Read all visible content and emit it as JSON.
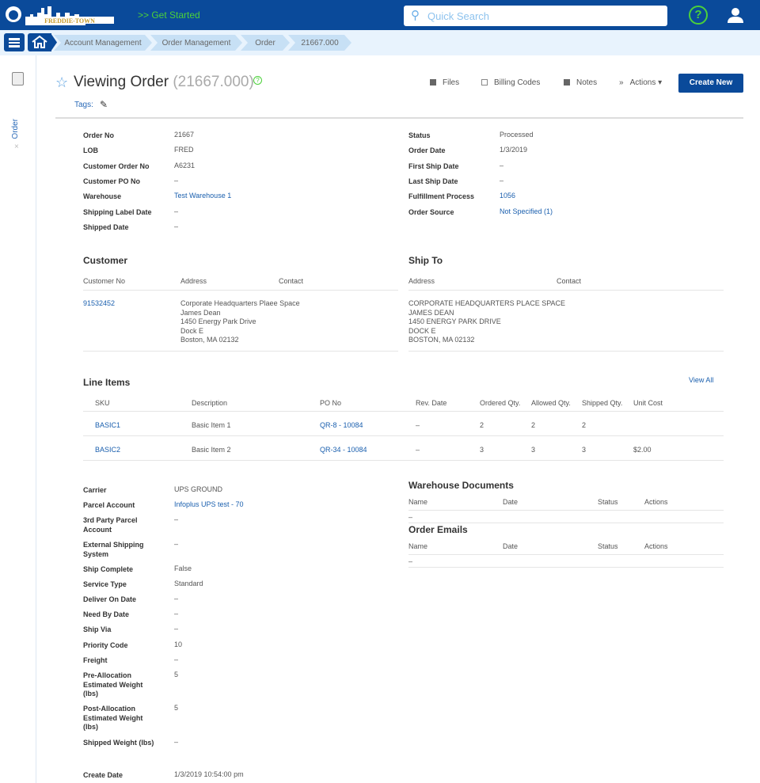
{
  "header": {
    "logo_text": "FREDDIE-TOWN",
    "get_started": ">> Get Started",
    "search_placeholder": "Quick Search",
    "help": "?"
  },
  "breadcrumb": [
    "Account Management",
    "Order Management",
    "Order",
    "21667.000"
  ],
  "sidebar": {
    "tab": "Order",
    "close": "×"
  },
  "page": {
    "title": "Viewing Order",
    "order_id": "(21667.000)",
    "tags_label": "Tags:"
  },
  "toolbar": {
    "files": "Files",
    "billing_codes": "Billing Codes",
    "notes": "Notes",
    "actions": "Actions ▾",
    "create_new": "Create New"
  },
  "order_fields_left": [
    {
      "label": "Order No",
      "value": "21667"
    },
    {
      "label": "LOB",
      "value": "FRED"
    },
    {
      "label": "Customer Order No",
      "value": "A6231"
    },
    {
      "label": "Customer PO No",
      "value": "–"
    },
    {
      "label": "Warehouse",
      "value": "Test Warehouse 1",
      "link": true
    },
    {
      "label": "Shipping Label Date",
      "value": "–"
    },
    {
      "label": "Shipped Date",
      "value": "–"
    }
  ],
  "order_fields_right": [
    {
      "label": "Status",
      "value": "Processed"
    },
    {
      "label": "Order Date",
      "value": "1/3/2019"
    },
    {
      "label": "First Ship Date",
      "value": "–"
    },
    {
      "label": "Last Ship Date",
      "value": "–"
    },
    {
      "label": "Fulfillment Process",
      "value": "1056",
      "link": true
    },
    {
      "label": "Order Source",
      "value": "Not Specified (1)",
      "link": true
    }
  ],
  "customer": {
    "heading": "Customer",
    "cols": [
      "Customer No",
      "Address",
      "Contact"
    ],
    "customer_no": "91532452",
    "address": [
      "Corporate Headquarters Plaee Space",
      "James Dean",
      "1450 Energy Park Drive",
      "Dock E",
      "Boston, MA 02132"
    ]
  },
  "ship_to": {
    "heading": "Ship To",
    "cols": [
      "Address",
      "Contact"
    ],
    "address": [
      "CORPORATE HEADQUARTERS PLACE SPACE",
      "JAMES DEAN",
      "1450 ENERGY PARK DRIVE",
      "DOCK E",
      "BOSTON, MA 02132"
    ]
  },
  "line_items": {
    "heading": "Line Items",
    "view_all": "View All",
    "cols": [
      "SKU",
      "Description",
      "PO No",
      "Rev. Date",
      "Ordered Qty.",
      "Allowed Qty.",
      "Shipped Qty.",
      "Unit Cost"
    ],
    "rows": [
      [
        "BASIC1",
        "Basic Item 1",
        "QR-8 - 10084",
        "–",
        "2",
        "2",
        "2",
        ""
      ],
      [
        "BASIC2",
        "Basic Item 2",
        "QR-34 - 10084",
        "–",
        "3",
        "3",
        "3",
        "$2.00"
      ]
    ]
  },
  "shipping_fields": [
    {
      "label": "Carrier",
      "value": "UPS GROUND"
    },
    {
      "label": "Parcel Account",
      "value": "Infoplus UPS test - 70",
      "link": true
    },
    {
      "label": "3rd Party Parcel Account",
      "value": "–"
    },
    {
      "label": "External Shipping System",
      "value": "–"
    },
    {
      "label": "Ship Complete",
      "value": "False"
    },
    {
      "label": "Service Type",
      "value": "Standard"
    },
    {
      "label": "Deliver On Date",
      "value": "–"
    },
    {
      "label": "Need By Date",
      "value": "–"
    },
    {
      "label": "Ship Via",
      "value": "–"
    },
    {
      "label": "Priority Code",
      "value": "10"
    },
    {
      "label": "Freight",
      "value": "–"
    },
    {
      "label": "Pre-Allocation Estimated Weight (lbs)",
      "value": "5"
    },
    {
      "label": "Post-Allocation Estimated Weight (lbs)",
      "value": "5"
    },
    {
      "label": "Shipped Weight (lbs)",
      "value": "–"
    },
    {
      "label": "Create Date",
      "value": "1/3/2019  10:54:00 pm"
    }
  ],
  "warehouse_documents": {
    "heading": "Warehouse Documents",
    "cols": [
      "Name",
      "Date",
      "Status",
      "Actions"
    ],
    "empty": "–"
  },
  "order_emails": {
    "heading": "Order Emails",
    "cols": [
      "Name",
      "Date",
      "Status",
      "Actions"
    ],
    "empty": "–"
  },
  "colors": {
    "brand": "#0a4a9a",
    "accent_green": "#4cd13a",
    "link": "#1a5fae"
  }
}
